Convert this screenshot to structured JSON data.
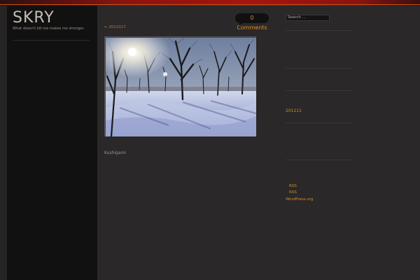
{
  "site": {
    "title": "SKRY",
    "tagline": "What doesn't kill me makes me stronger."
  },
  "post": {
    "comments_label": "0 Comments",
    "prev_link": "← 2012117",
    "tag": "Kushigami",
    "image_alt": "Snowy park with bare trees and low sun"
  },
  "sidebar": {
    "search_placeholder": "Search ...",
    "archive_link": "201211",
    "meta_links": [
      "RSS",
      "RSS",
      "WordPress.org"
    ]
  },
  "colors": {
    "accent": "#d2912e",
    "header_bar": "#a3150f",
    "background": "#2a2828",
    "left_sidebar": "#121111"
  }
}
